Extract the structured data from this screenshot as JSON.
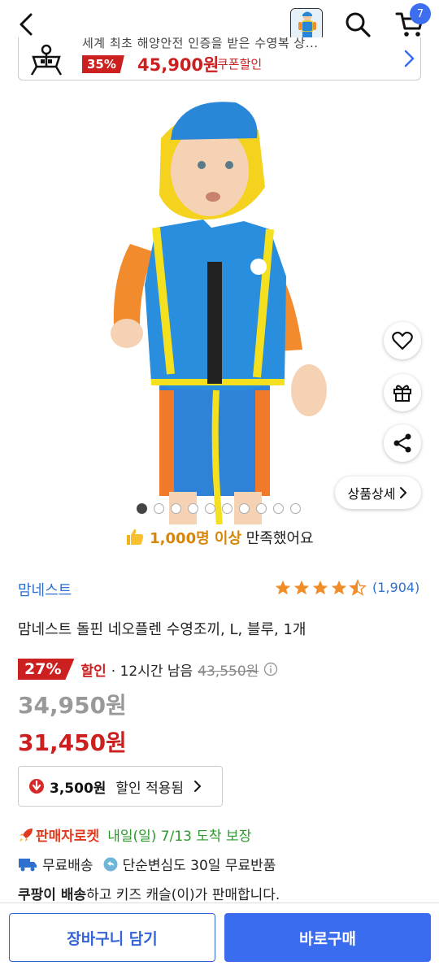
{
  "header": {
    "cart_count": "7"
  },
  "promo": {
    "cut_text": "세계 최초 해양안전 인증을 받은 수영복 상...",
    "discount": "35%",
    "price": "45,900원",
    "coupon": "쿠폰할인"
  },
  "hero": {
    "dots_total": 10,
    "dots_active_index": 0,
    "detail_label": "상품상세"
  },
  "satisfaction": {
    "highlight": "1,000명 이상",
    "rest": " 만족했어요"
  },
  "product": {
    "brand": "맘네스트",
    "rating": 4.5,
    "reviews": "(1,904)",
    "title": "맘네스트 돌핀 네오플렌 수영조끼, L, 블루, 1개"
  },
  "pricing": {
    "discount_badge": "27%",
    "discount_label": "할인",
    "time_left": "· 12시간 남음",
    "original_price": "43,550원",
    "old_price": "34,950원",
    "new_price": "31,450원",
    "applied_amount": "3,500원",
    "applied_text": "할인 적용됨"
  },
  "shipping": {
    "rocket_label": "판매자로켓",
    "date": "내일(일) 7/13 도착 보장",
    "free_shipping": "무료배송",
    "free_return": "단순변심도 30일 무료반품",
    "seller_bold": "쿠팡이 배송",
    "seller_rest": "하고 키즈 캐슬(이)가 판매합니다."
  },
  "actions": {
    "add_to_cart": "장바구니 담기",
    "buy_now": "바로구매"
  },
  "colors": {
    "accent_blue": "#3a6cef",
    "discount_red": "#cc1f1f",
    "satisfaction_orange": "#d9850a",
    "shipping_green": "#2b9a2b"
  }
}
